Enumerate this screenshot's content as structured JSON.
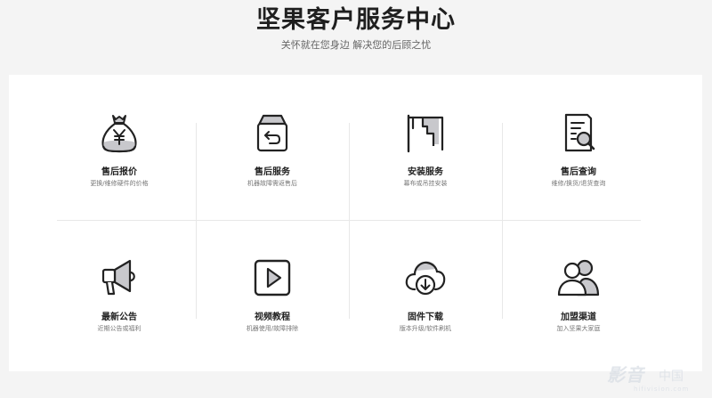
{
  "header": {
    "title": "坚果客户服务中心",
    "subtitle": "关怀就在您身边 解决您的后顾之忧"
  },
  "services": [
    {
      "title": "售后报价",
      "desc": "更换/维修硬件的价格",
      "icon": "money-bag-icon"
    },
    {
      "title": "售后服务",
      "desc": "机器故障需返售后",
      "icon": "return-box-icon"
    },
    {
      "title": "安装服务",
      "desc": "幕布或吊挂安装",
      "icon": "ceiling-mount-icon"
    },
    {
      "title": "售后查询",
      "desc": "维修/换货/退货查询",
      "icon": "document-search-icon"
    },
    {
      "title": "最新公告",
      "desc": "近期公告或福利",
      "icon": "megaphone-icon"
    },
    {
      "title": "视频教程",
      "desc": "机器使用/故障排除",
      "icon": "play-video-icon"
    },
    {
      "title": "固件下载",
      "desc": "版本升级/软件刷机",
      "icon": "cloud-download-icon"
    },
    {
      "title": "加盟渠道",
      "desc": "加入坚果大家庭",
      "icon": "people-group-icon"
    }
  ],
  "watermark": {
    "brand": "影音",
    "sub": "中国",
    "url": "hifivision.com"
  },
  "colors": {
    "background": "#f4f4f4",
    "panel": "#ffffff",
    "icon_stroke": "#222222",
    "icon_fill": "#c8c8cc",
    "divider": "#e8e8e8"
  }
}
